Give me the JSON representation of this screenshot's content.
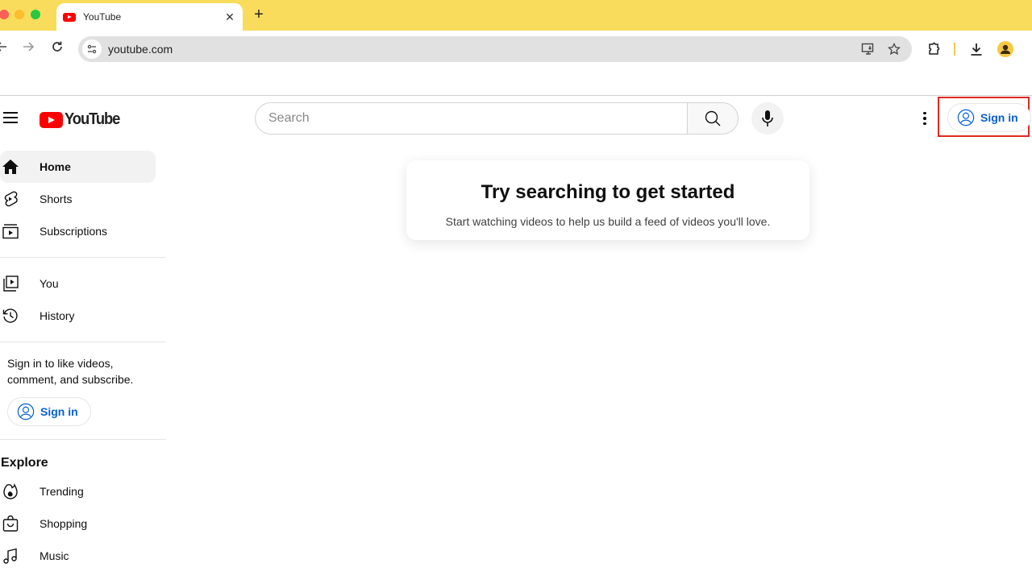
{
  "browser": {
    "tab": {
      "title": "YouTube"
    },
    "url": "youtube.com",
    "new_tab_label": "+",
    "close_tab_label": "✕"
  },
  "masthead": {
    "logo_text": "YouTube",
    "search": {
      "placeholder": "Search",
      "value": ""
    },
    "sign_in_label": "Sign in"
  },
  "sidebar": {
    "primary": [
      {
        "label": "Home",
        "icon": "home-icon",
        "active": true
      },
      {
        "label": "Shorts",
        "icon": "shorts-icon",
        "active": false
      },
      {
        "label": "Subscriptions",
        "icon": "subscriptions-icon",
        "active": false
      }
    ],
    "secondary": [
      {
        "label": "You",
        "icon": "you-icon"
      },
      {
        "label": "History",
        "icon": "history-icon"
      }
    ],
    "signin_prompt": "Sign in to like videos, comment, and subscribe.",
    "signin_label": "Sign in",
    "explore": {
      "title": "Explore",
      "items": [
        {
          "label": "Trending",
          "icon": "trending-icon"
        },
        {
          "label": "Shopping",
          "icon": "shopping-icon"
        },
        {
          "label": "Music",
          "icon": "music-icon"
        }
      ]
    }
  },
  "main": {
    "title": "Try searching to get started",
    "subtitle": "Start watching videos to help us build a feed of videos you'll love."
  },
  "colors": {
    "tabstrip": "#f9dc5c",
    "brand_red": "#ff0000",
    "link_blue": "#065fd4",
    "highlight_box": "#e02a1f"
  }
}
